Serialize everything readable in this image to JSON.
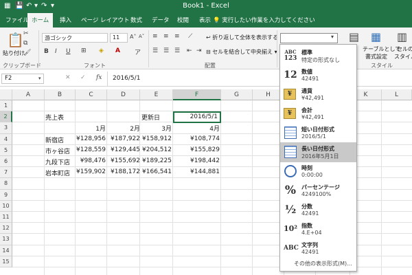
{
  "titlebar": {
    "title": "Book1 - Excel"
  },
  "tabs": [
    "ファイル",
    "ホーム",
    "挿入",
    "ページ レイアウト",
    "数式",
    "データ",
    "校閲",
    "表示"
  ],
  "tell_me": "実行したい作業を入力してください",
  "ribbon": {
    "font_name": "游ゴシック",
    "font_size": "11",
    "paste_label": "貼り付け",
    "wrap_text": "折り返して全体を表示する",
    "merge_center": "セルを結合して中央揃え",
    "number_format_value": "",
    "groups": {
      "clipboard": "クリップボード",
      "font": "フォント",
      "alignment": "配置",
      "styles": "スタイル"
    },
    "styles_buttons": {
      "table_line1": "テーブルとして",
      "table_line2": "書式設定",
      "cell_line1": "セルの",
      "cell_line2": "スタイル"
    },
    "bold": "B",
    "italic": "I",
    "underline": "U"
  },
  "formula_bar": {
    "name_box": "F2",
    "fx": "fx",
    "value": "2016/5/1"
  },
  "grid": {
    "columns": [
      "A",
      "B",
      "C",
      "D",
      "E",
      "F",
      "G",
      "H",
      "I",
      "J",
      "K",
      "L"
    ],
    "rows": [
      "1",
      "2",
      "3",
      "4",
      "5",
      "6",
      "7",
      "8",
      "9",
      "10",
      "11",
      "12",
      "13",
      "14",
      "15"
    ],
    "title": "売上表",
    "updated_label": "更新日",
    "updated_value": "2016/5/1",
    "months": [
      "1月",
      "2月",
      "3月",
      "4月"
    ],
    "stores": [
      {
        "name": "新宿店",
        "values": [
          "¥128,956",
          "¥187,922",
          "¥158,912",
          "¥108,774"
        ]
      },
      {
        "name": "市ヶ谷店",
        "values": [
          "¥128,559",
          "¥129,445",
          "¥204,512",
          "¥155,829"
        ]
      },
      {
        "name": "九段下店",
        "values": [
          "¥98,476",
          "¥155,692",
          "¥189,225",
          "¥198,442"
        ]
      },
      {
        "name": "岩本町店",
        "values": [
          "¥159,902",
          "¥188,172",
          "¥166,541",
          "¥144,881"
        ]
      }
    ]
  },
  "number_formats": [
    {
      "icon": "ABC/123",
      "name": "標準",
      "sample": "特定の形式なし",
      "icon_text": "ABC",
      "icon_text2": "123"
    },
    {
      "icon": "number-icon",
      "name": "数値",
      "sample": "42491",
      "icon_text": "12"
    },
    {
      "icon": "currency-icon",
      "name": "通貨",
      "sample": "¥42,491",
      "icon_text": "¥"
    },
    {
      "icon": "accounting-icon",
      "name": "会計",
      "sample": " ¥42,491",
      "icon_text": "¥"
    },
    {
      "icon": "short-date-icon",
      "name": "短い日付形式",
      "sample": "2016/5/1",
      "icon_text": ""
    },
    {
      "icon": "long-date-icon",
      "name": "長い日付形式",
      "sample": "2016年5月1日",
      "icon_text": ""
    },
    {
      "icon": "time-icon",
      "name": "時刻",
      "sample": "0:00:00",
      "icon_text": ""
    },
    {
      "icon": "percent-icon",
      "name": "パーセンテージ",
      "sample": "4249100%",
      "icon_text": "%"
    },
    {
      "icon": "fraction-icon",
      "name": "分数",
      "sample": "42491",
      "icon_text": "½"
    },
    {
      "icon": "scientific-icon",
      "name": "指数",
      "sample": "4.E+04",
      "icon_text": "10²"
    },
    {
      "icon": "text-icon",
      "name": "文字列",
      "sample": "42491",
      "icon_text": "ABC"
    }
  ],
  "more_formats": "その他の表示形式(M)...",
  "colors": {
    "excel_green": "#217346",
    "selected_item": "#c9c9c9"
  }
}
